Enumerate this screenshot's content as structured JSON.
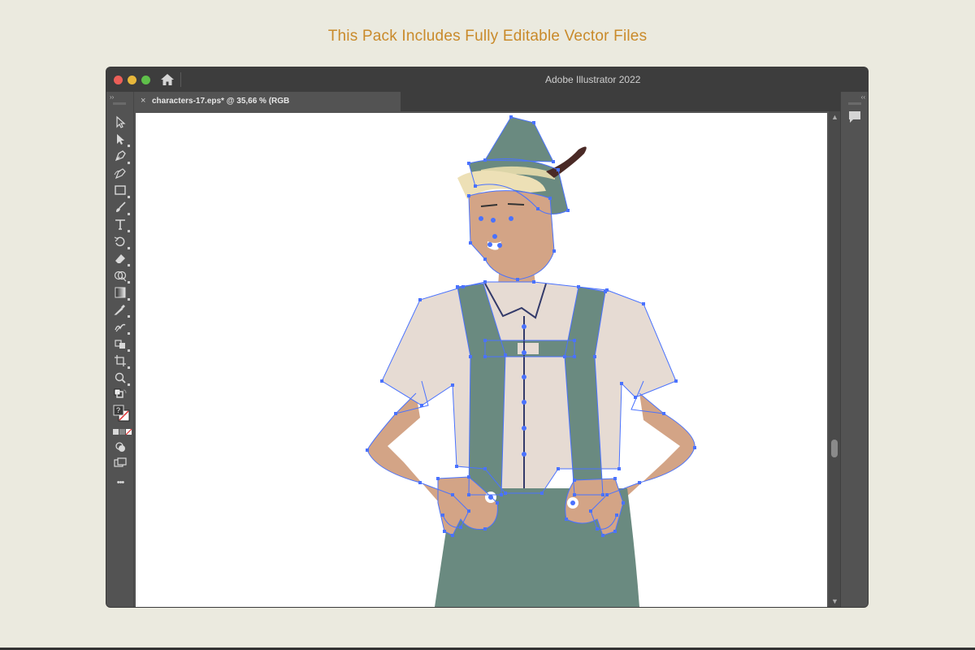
{
  "page": {
    "headline": "This Pack Includes Fully Editable Vector Files"
  },
  "window": {
    "app_title": "Adobe Illustrator 2022",
    "document_tab": "characters-17.eps* @ 35,66 % (RGB",
    "close_glyph": "×"
  },
  "toolbar": {
    "collapse_glyph": "››",
    "tools": [
      "selection-tool",
      "direct-selection-tool",
      "pen-tool",
      "curvature-tool",
      "rectangle-tool",
      "paintbrush-tool",
      "type-tool",
      "rotate-tool",
      "eraser-tool",
      "shape-builder-tool",
      "gradient-tool",
      "eyedropper-tool",
      "blend-tool",
      "live-paint-tool",
      "artboard-tool",
      "zoom-tool",
      "fill-stroke-swap",
      "fill-stroke-swatches",
      "color-mode-buttons",
      "draw-mode",
      "screen-mode",
      "more-tools"
    ],
    "fill_stroke_label": "?",
    "more_label": "•••"
  },
  "right_panel": {
    "collapse_glyph": "‹‹"
  },
  "colors": {
    "background": "#ebeadf",
    "headline": "#c98a2a",
    "window_chrome": "#3d3d3d",
    "panel": "#535353",
    "artboard": "#ffffff",
    "path_selection": "#4a72ff",
    "hat_green": "#6a8a80",
    "skin": "#d3a486",
    "shirt": "#e6dbd3",
    "hair": "#ede0b6",
    "feather": "#4a2a26"
  }
}
